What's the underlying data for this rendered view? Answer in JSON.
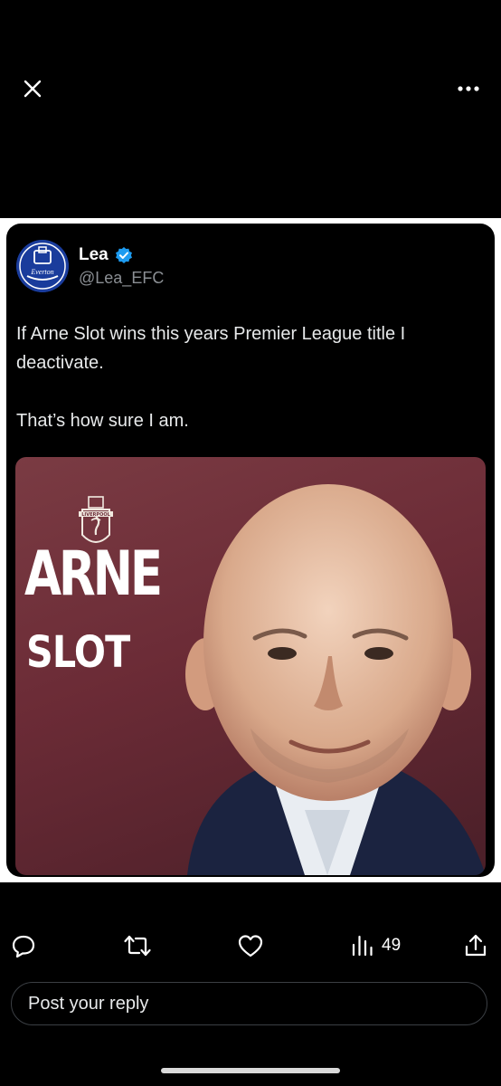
{
  "header": {
    "close_icon": "close-icon",
    "more_icon": "more-horizontal-icon"
  },
  "tweet_image": {
    "display_name": "Lea",
    "handle": "@Lea_EFC",
    "avatar": "everton-crest",
    "avatar_text": "Everton",
    "verified": true,
    "text_line_1": "If Arne Slot wins this years Premier League title I deactivate.",
    "text_line_2": "That’s how sure I am.",
    "photo": {
      "title_1": "ARNE",
      "title_2": "SLOT",
      "crest_text": "LIVERPOOL",
      "background_color": "#6b2b36"
    }
  },
  "actions": {
    "reply_icon": "reply-icon",
    "retweet_icon": "retweet-icon",
    "like_icon": "heart-icon",
    "views_icon": "views-icon",
    "views_count": "49",
    "share_icon": "share-icon"
  },
  "reply": {
    "placeholder": "Post your reply"
  },
  "colors": {
    "background": "#000000",
    "verified_blue": "#1d9bf0",
    "muted_text": "#8b8f94"
  }
}
